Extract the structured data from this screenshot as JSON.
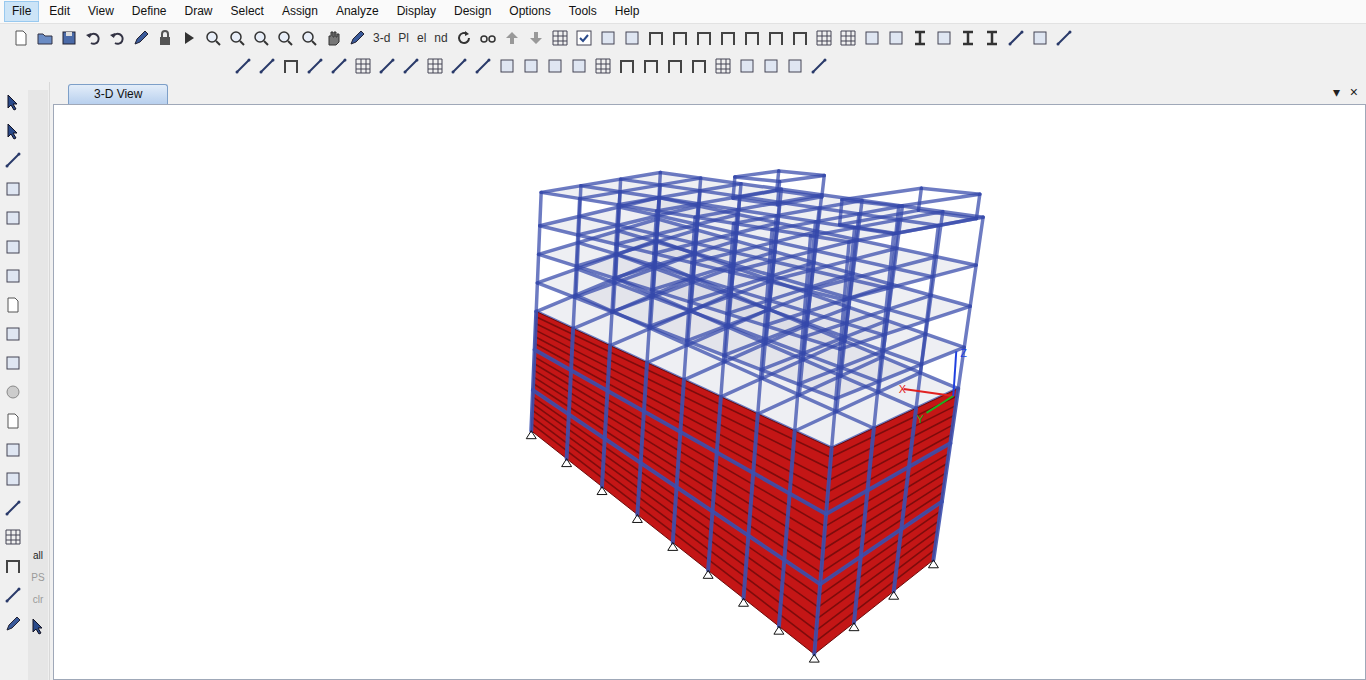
{
  "menu": [
    {
      "label": "File",
      "selected": true
    },
    {
      "label": "Edit",
      "selected": false
    },
    {
      "label": "View",
      "selected": false
    },
    {
      "label": "Define",
      "selected": false
    },
    {
      "label": "Draw",
      "selected": false
    },
    {
      "label": "Select",
      "selected": false
    },
    {
      "label": "Assign",
      "selected": false
    },
    {
      "label": "Analyze",
      "selected": false
    },
    {
      "label": "Display",
      "selected": false
    },
    {
      "label": "Design",
      "selected": false
    },
    {
      "label": "Options",
      "selected": false
    },
    {
      "label": "Tools",
      "selected": false
    },
    {
      "label": "Help",
      "selected": false
    }
  ],
  "toolbar": {
    "text_buttons": [
      "3-d",
      "Pl",
      "el",
      "nd"
    ]
  },
  "left_toolbar": {
    "select_buttons": [
      {
        "label": "all",
        "disabled": false
      },
      {
        "label": "PS",
        "disabled": true
      },
      {
        "label": "clr",
        "disabled": true
      }
    ]
  },
  "view_tabs": [
    {
      "label": "3-D View",
      "selected": true
    }
  ],
  "view_controls": [
    "▾",
    "×"
  ],
  "model_view": {
    "axes": [
      {
        "label": "X",
        "color": "#e02020"
      },
      {
        "label": "Y",
        "color": "#20b020"
      },
      {
        "label": "Z",
        "color": "#2040e0"
      }
    ]
  }
}
